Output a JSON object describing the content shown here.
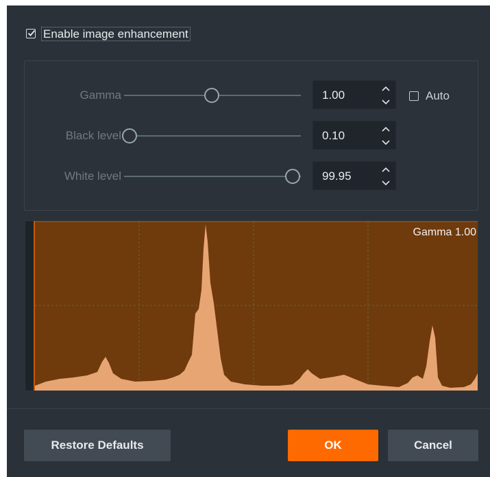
{
  "enhancement": {
    "checkbox_checked": true,
    "label": "Enable image enhancement"
  },
  "controls": {
    "gamma": {
      "label": "Gamma",
      "value": "1.00",
      "slider_fraction": 0.5
    },
    "black_level": {
      "label": "Black level",
      "value": "0.10",
      "slider_fraction": 0.0
    },
    "white_level": {
      "label": "White level",
      "value": "99.95",
      "slider_fraction": 1.0
    },
    "auto": {
      "label": "Auto",
      "checked": false
    }
  },
  "histogram": {
    "caption": "Gamma 1.00",
    "fill_color": "#6f3a0c",
    "bars_color": "#e8a574",
    "grid_color": "#5a7030"
  },
  "buttons": {
    "restore": "Restore Defaults",
    "ok": "OK",
    "cancel": "Cancel"
  },
  "colors": {
    "dialog_bg": "#2a3138",
    "accent": "#ff6a00"
  }
}
